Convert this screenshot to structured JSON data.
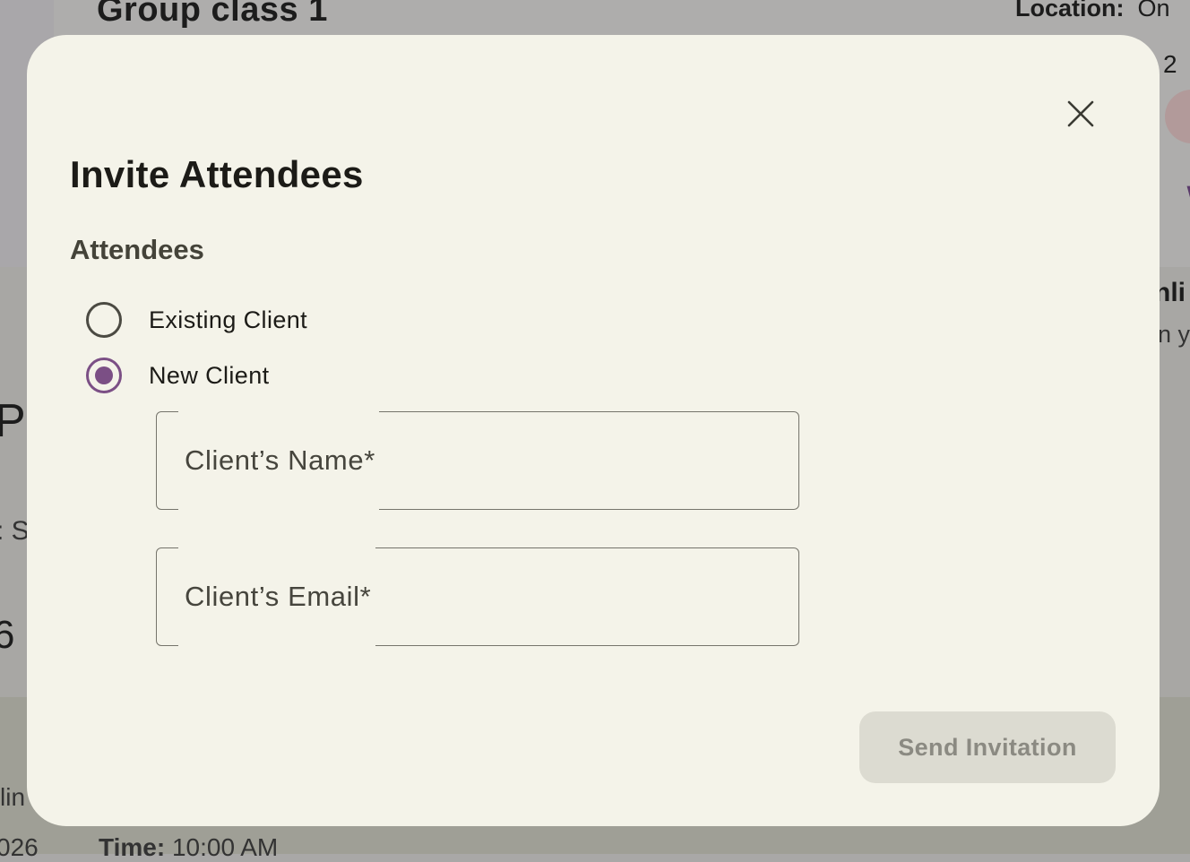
{
  "background": {
    "page_title": "Group class 1",
    "location_label": "Location:",
    "location_value": "On",
    "right_fragment_number": "2",
    "right_fragment_heading": "nli",
    "right_fragment_text": "n y",
    "left_fragment_heading": "Pa",
    "left_fragment_text": ": S",
    "left_fragment_digit": "6",
    "footer_fragment_1": "lin",
    "footer_fragment_year": "026",
    "time_label": "Time:",
    "time_value": "10:00 AM"
  },
  "dialog": {
    "title": "Invite Attendees",
    "section_label": "Attendees",
    "options": [
      {
        "label": "Existing Client",
        "selected": false
      },
      {
        "label": "New Client",
        "selected": true
      }
    ],
    "fields": {
      "name": {
        "label": "Client’s Name*",
        "value": ""
      },
      "email": {
        "label": "Client’s Email*",
        "value": ""
      }
    },
    "submit_label": "Send Invitation",
    "submit_disabled": true,
    "close_icon": "close-icon"
  },
  "colors": {
    "dialog_bg": "#f4f3e9",
    "accent": "#7b4f85",
    "scrim": "#a9a8a7",
    "button_disabled_bg": "#dcdbd1",
    "button_disabled_text": "#8b8a82"
  }
}
